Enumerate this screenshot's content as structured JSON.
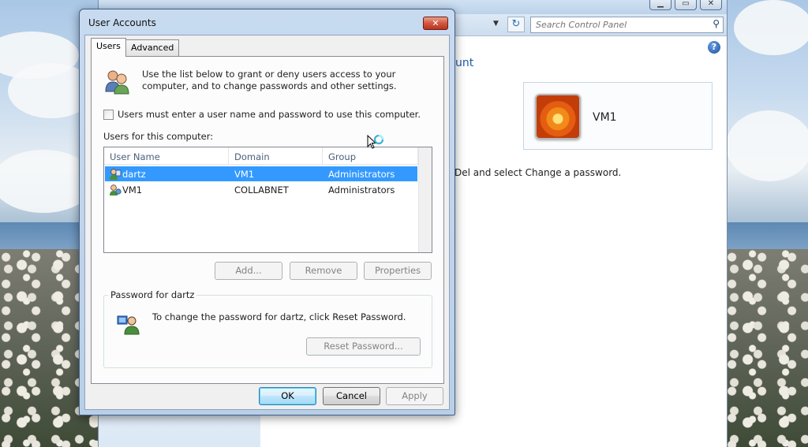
{
  "control_panel": {
    "search": {
      "placeholder": "Search Control Panel"
    },
    "heading_partial": "unt",
    "user_tile": {
      "name": "VM1"
    },
    "ctrl_alt_del_text": "Del and select Change a password.",
    "caption_buttons": {
      "minimize": "▁",
      "maximize": "▭",
      "close": "✕"
    },
    "refresh_glyph": "↻",
    "help_glyph": "?"
  },
  "dialog": {
    "title": "User Accounts",
    "close_glyph": "✕",
    "tabs": [
      {
        "label": "Users",
        "active": true
      },
      {
        "label": "Advanced",
        "active": false
      }
    ],
    "intro_text": "Use the list below to grant or deny users access to your computer, and to change passwords and other settings.",
    "checkbox": {
      "label": "Users must enter a user name and password to use this computer.",
      "checked": false
    },
    "users_label": "Users for this computer:",
    "columns": [
      "User Name",
      "Domain",
      "Group"
    ],
    "users": [
      {
        "name": "dartz",
        "domain": "VM1",
        "group": "Administrators",
        "selected": true
      },
      {
        "name": "VM1",
        "domain": "COLLABNET",
        "group": "Administrators",
        "selected": false
      }
    ],
    "buttons": {
      "add": "Add...",
      "remove": "Remove",
      "properties": "Properties"
    },
    "password_group": {
      "legend": "Password for dartz",
      "text": "To change the password for dartz, click Reset Password.",
      "reset_button": "Reset Password..."
    },
    "footer": {
      "ok": "OK",
      "cancel": "Cancel",
      "apply": "Apply"
    }
  },
  "colors": {
    "selection": "#3399ff",
    "link_blue": "#1e5aa8",
    "close_red": "#c63f26"
  },
  "icons": [
    "users-icon",
    "user-row-icon",
    "password-user-icon",
    "search-icon",
    "refresh-icon",
    "help-icon",
    "busy-cursor-icon"
  ]
}
